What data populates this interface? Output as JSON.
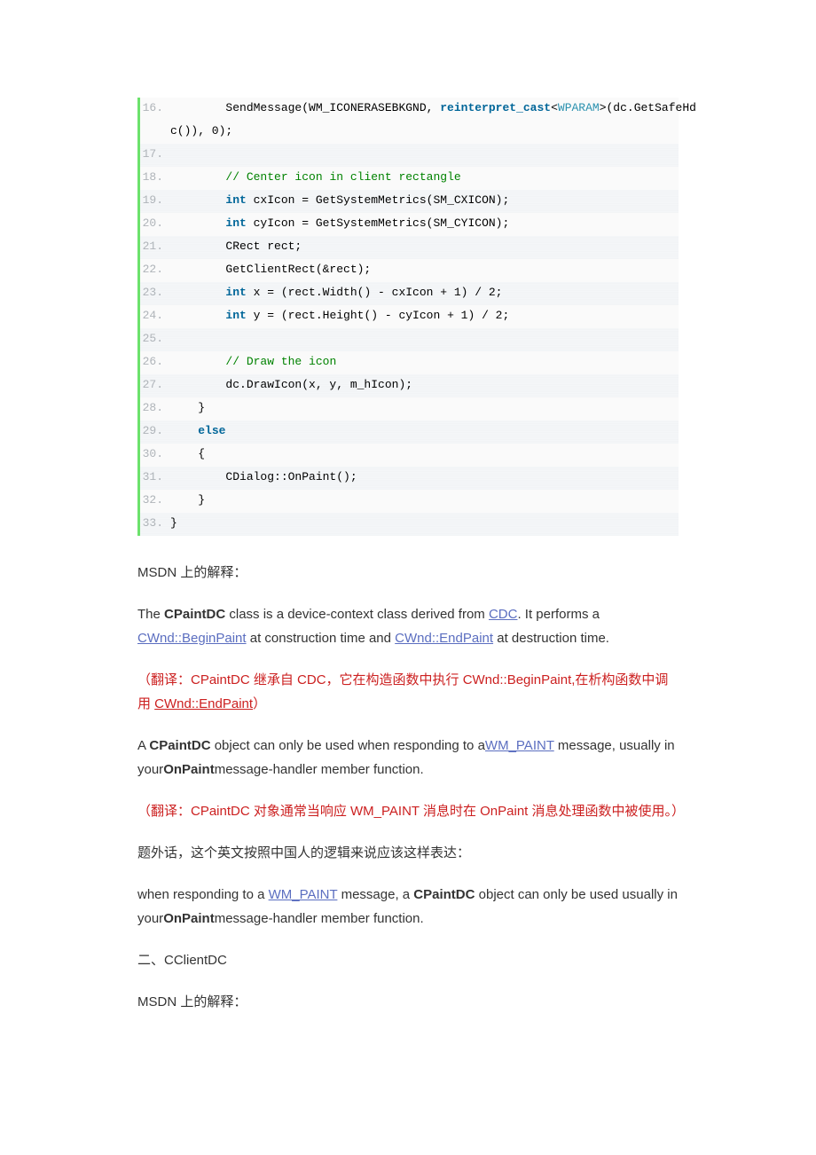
{
  "code": {
    "lines": [
      {
        "n": "16.",
        "html": "        SendMessage(WM_ICONERASEBKGND, <span class=\"kw\">reinterpret_cast</span>&lt;<span class=\"tpname\">WPARAM</span>&gt;(dc.GetSafeHd"
      },
      {
        "n": "",
        "html": "c()), 0);  ",
        "cont": true
      },
      {
        "n": "17.",
        "html": "  "
      },
      {
        "n": "18.",
        "html": "        <span class=\"cm\">// Center icon in client rectangle  </span>"
      },
      {
        "n": "19.",
        "html": "        <span class=\"tp\">int</span> cxIcon = GetSystemMetrics(SM_CXICON);  "
      },
      {
        "n": "20.",
        "html": "        <span class=\"tp\">int</span> cyIcon = GetSystemMetrics(SM_CYICON);  "
      },
      {
        "n": "21.",
        "html": "        CRect rect;  "
      },
      {
        "n": "22.",
        "html": "        GetClientRect(&amp;rect);  "
      },
      {
        "n": "23.",
        "html": "        <span class=\"tp\">int</span> x = (rect.Width() - cxIcon + 1) / 2;  "
      },
      {
        "n": "24.",
        "html": "        <span class=\"tp\">int</span> y = (rect.Height() - cyIcon + 1) / 2;  "
      },
      {
        "n": "25.",
        "html": "  "
      },
      {
        "n": "26.",
        "html": "        <span class=\"cm\">// Draw the icon  </span>"
      },
      {
        "n": "27.",
        "html": "        dc.DrawIcon(x, y, m_hIcon);  "
      },
      {
        "n": "28.",
        "html": "    }  "
      },
      {
        "n": "29.",
        "html": "    <span class=\"kw\">else</span>  "
      },
      {
        "n": "30.",
        "html": "    {  "
      },
      {
        "n": "31.",
        "html": "        CDialog::OnPaint();  "
      },
      {
        "n": "32.",
        "html": "    }  "
      },
      {
        "n": "33.",
        "html": "}  "
      }
    ]
  },
  "p1": "MSDN 上的解释：",
  "p2a": "The ",
  "p2b": "CPaintDC",
  "p2c": " class is a device-context class derived from ",
  "p2d": "CDC",
  "p2e": ". It performs a ",
  "p2f": "CWnd::BeginPaint",
  "p2g": " at construction time and ",
  "p2h": "CWnd::EndPaint",
  "p2i": " at destruction time.",
  "p3a": "（翻译：CPaintDC 继承自 CDC，它在构造函数中执行 CWnd::BeginPaint,在析构函数中调用 ",
  "p3b": "CWnd::EndPaint",
  "p3c": "）",
  "p4a": " A ",
  "p4b": "CPaintDC",
  "p4c": " object can only be used when responding to a",
  "p4d": "WM_PAINT",
  "p4e": " message, usually in your",
  "p4f": "OnPaint",
  "p4g": "message-handler member function.",
  "p5": "（翻译：CPaintDC 对象通常当响应 WM_PAINT 消息时在 OnPaint 消息处理函数中被使用。）",
  "p6": "题外话，这个英文按照中国人的逻辑来说应该这样表达：",
  "p7a": "when responding to a ",
  "p7b": "WM_PAINT",
  "p7c": " message, a ",
  "p7d": "CPaintDC",
  "p7e": " object can only be used usually in your",
  "p7f": "OnPaint",
  "p7g": "message-handler member function.",
  "p8": " 二、CClientDC",
  "p9": "MSDN 上的解释："
}
